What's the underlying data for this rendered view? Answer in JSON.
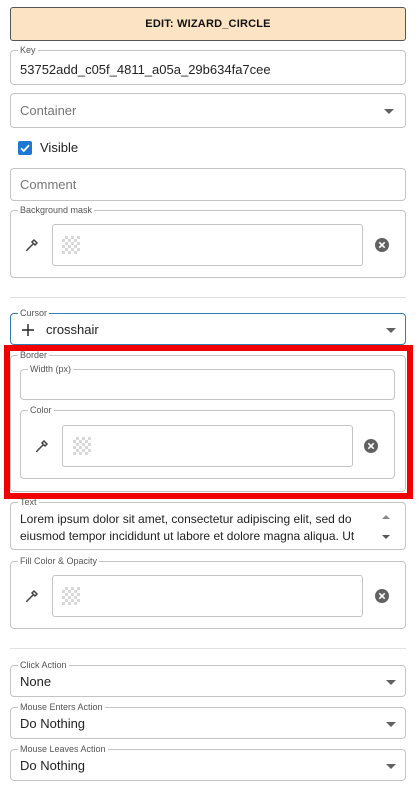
{
  "header": {
    "title": "EDIT: WIZARD_CIRCLE"
  },
  "key": {
    "label": "Key",
    "value": "53752add_c05f_4811_a05a_29b634fa7cee"
  },
  "container": {
    "placeholder": "Container"
  },
  "visible": {
    "label": "Visible",
    "checked": true
  },
  "comment": {
    "placeholder": "Comment"
  },
  "background_mask": {
    "label": "Background mask"
  },
  "cursor": {
    "label": "Cursor",
    "value": "crosshair"
  },
  "border": {
    "label": "Border",
    "width": {
      "label": "Width (px)",
      "value": ""
    },
    "color": {
      "label": "Color"
    }
  },
  "text": {
    "label": "Text",
    "line1": "Lorem ipsum dolor sit amet, consectetur adipiscing elit, sed do",
    "line2": "eiusmod tempor incididunt ut labore et dolore magna aliqua. Ut"
  },
  "fill_color": {
    "label": "Fill Color & Opacity"
  },
  "click_action": {
    "label": "Click Action",
    "value": "None"
  },
  "mouse_enters_action": {
    "label": "Mouse Enters Action",
    "value": "Do Nothing"
  },
  "mouse_leaves_action": {
    "label": "Mouse Leaves Action",
    "value": "Do Nothing"
  },
  "colors": {
    "header_bg": "#fbe3c4",
    "checkbox": "#1e78d2",
    "highlight": "#f00000",
    "active_border": "#2e7eb8"
  }
}
